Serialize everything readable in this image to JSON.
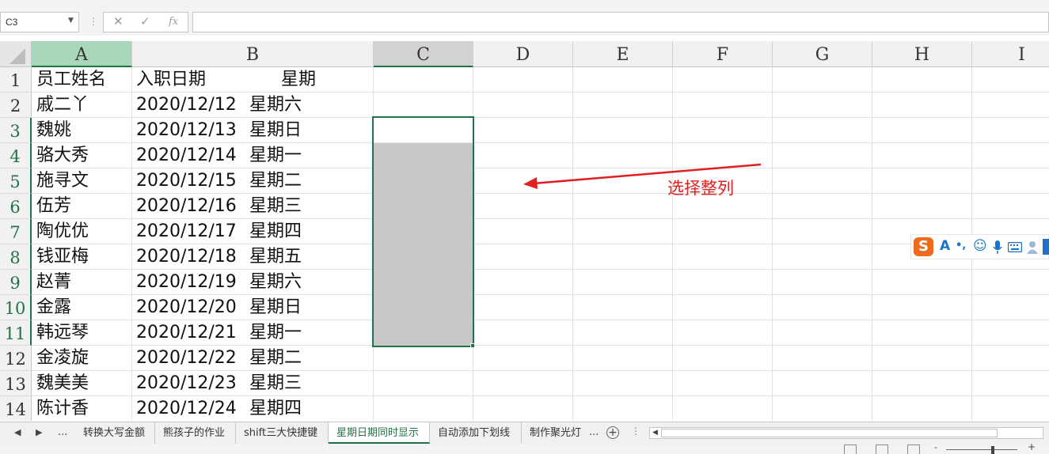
{
  "formula_bar": {
    "name_box": "C3",
    "sep": "⋮",
    "cancel_glyph": "✕",
    "confirm_glyph": "✓",
    "fx_glyph": "fx",
    "value": ""
  },
  "columns": [
    "A",
    "B",
    "C",
    "D",
    "E",
    "F",
    "G",
    "H",
    "I"
  ],
  "rows": [
    "1",
    "2",
    "3",
    "4",
    "5",
    "6",
    "7",
    "8",
    "9",
    "10",
    "11",
    "12",
    "13",
    "14"
  ],
  "cells": [
    [
      "员工姓名",
      "入职日期",
      "星期"
    ],
    [
      "戚二丫",
      "2020/12/12",
      "星期六"
    ],
    [
      "魏姚",
      "2020/12/13",
      "星期日"
    ],
    [
      "骆大秀",
      "2020/12/14",
      "星期一"
    ],
    [
      "施寻文",
      "2020/12/15",
      "星期二"
    ],
    [
      "伍芳",
      "2020/12/16",
      "星期三"
    ],
    [
      "陶优优",
      "2020/12/17",
      "星期四"
    ],
    [
      "钱亚梅",
      "2020/12/18",
      "星期五"
    ],
    [
      "赵菁",
      "2020/12/19",
      "星期六"
    ],
    [
      "金露",
      "2020/12/20",
      "星期日"
    ],
    [
      "韩远琴",
      "2020/12/21",
      "星期一"
    ],
    [
      "金凌旋",
      "2020/12/22",
      "星期二"
    ],
    [
      "魏美美",
      "2020/12/23",
      "星期三"
    ],
    [
      "陈计香",
      "2020/12/24",
      "星期四"
    ]
  ],
  "annotation": {
    "text": "选择整列",
    "color": "#e02020"
  },
  "accent_color": "#217346",
  "ime_toolbar": {
    "logo": "S",
    "items": [
      "A",
      "•,",
      "☺",
      "mic-icon",
      "keyboard-icon",
      "user-icon"
    ]
  },
  "sheet_tabs": {
    "nav_prev": "◀",
    "nav_next": "▶",
    "nav_more": "...",
    "tabs": [
      "转换大写金额",
      "熊孩子的作业",
      "shift三大快捷键",
      "星期日期同时显示",
      "自动添加下划线",
      "制作聚光灯"
    ],
    "active": "星期日期同时显示",
    "overflow": "...",
    "add_glyph": "+",
    "more_glyph": "⋮",
    "scroll_left": "◀"
  },
  "status_bar": {
    "zoom_minus": "-",
    "zoom_plus": "+"
  }
}
